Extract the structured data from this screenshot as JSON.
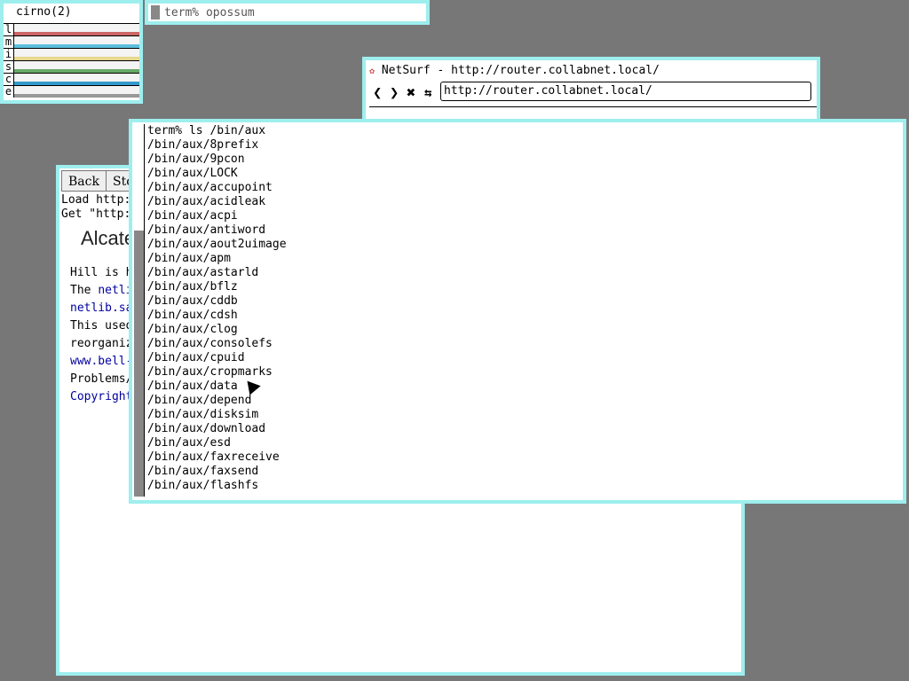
{
  "stats": {
    "title": "cirno(2)",
    "rows": [
      {
        "label": "l",
        "color": "#cc6666"
      },
      {
        "label": "m",
        "color": "#5cc0dd"
      },
      {
        "label": "i",
        "color": "#e6d890"
      },
      {
        "label": "s",
        "color": "#66aa66"
      },
      {
        "label": "c",
        "color": "#3399cc"
      },
      {
        "label": "e",
        "color": "#999999"
      }
    ]
  },
  "miniterm": {
    "text": "term% opossum"
  },
  "netsurf": {
    "title": "NetSurf - http://router.collabnet.local/",
    "url": "http://router.collabnet.local/"
  },
  "browser": {
    "back_label": "Back",
    "stop_label": "Sto",
    "load_line": "Load http:",
    "get_line": "Get \"http:",
    "logo_text": "Alcate",
    "hill_line": "Hill is h",
    "the_prefix": "The ",
    "the_link": "netli",
    "netlib_link": "netlib.sa",
    "this_line": "This used",
    "reorg_line": "reorganiz",
    "bell_link": "www.bell-",
    "problems_line": "Problems/",
    "copyright_link": "Copyright"
  },
  "term": {
    "lines": [
      "term% ls /bin/aux",
      "/bin/aux/8prefix",
      "/bin/aux/9pcon",
      "/bin/aux/LOCK",
      "/bin/aux/accupoint",
      "/bin/aux/acidleak",
      "/bin/aux/acpi",
      "/bin/aux/antiword",
      "/bin/aux/aout2uimage",
      "/bin/aux/apm",
      "/bin/aux/astarld",
      "/bin/aux/bflz",
      "/bin/aux/cddb",
      "/bin/aux/cdsh",
      "/bin/aux/clog",
      "/bin/aux/consolefs",
      "/bin/aux/cpuid",
      "/bin/aux/cropmarks",
      "/bin/aux/data",
      "/bin/aux/depend",
      "/bin/aux/disksim",
      "/bin/aux/download",
      "/bin/aux/esd",
      "/bin/aux/faxreceive",
      "/bin/aux/faxsend",
      "/bin/aux/flashfs"
    ]
  }
}
